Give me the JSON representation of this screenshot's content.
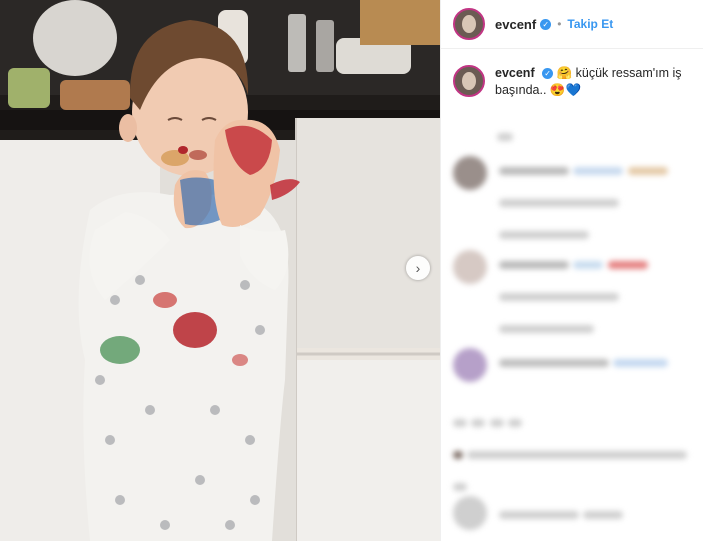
{
  "post": {
    "username": "evcenf",
    "follow_label": "Takip Et",
    "separator": "•",
    "caption": "küçük ressam'ım iş başında..",
    "caption_emoji_lead": "🤗",
    "caption_emoji_tail": "😍💙"
  },
  "icons": {
    "next": "chevron-right-icon",
    "verified": "verified-badge-icon"
  },
  "colors": {
    "link_blue": "#3897f0",
    "username_text": "#262626",
    "avatar_ring": "#c13584"
  }
}
